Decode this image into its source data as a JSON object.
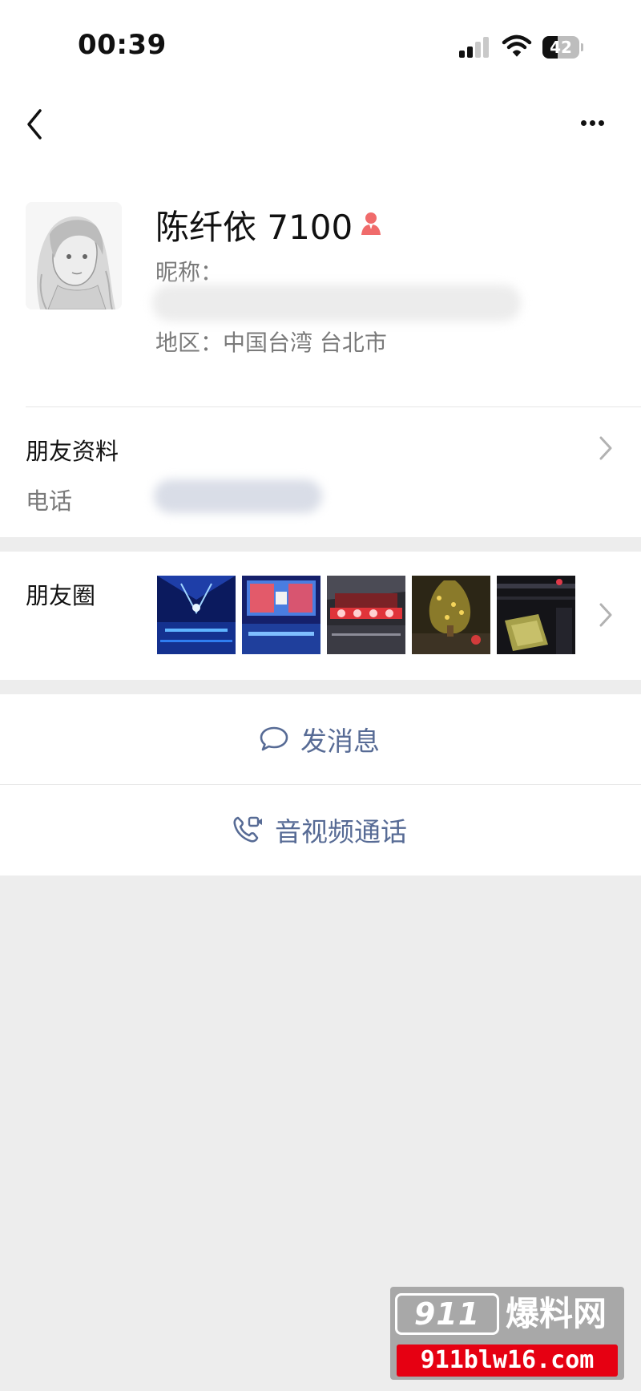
{
  "status_bar": {
    "time": "00:39",
    "battery": "42"
  },
  "profile": {
    "name": "陈纤依 7100",
    "nickname_label": "昵称：",
    "region": "地区：中国台湾 台北市"
  },
  "friend_info": {
    "title": "朋友资料",
    "phone_label": "电话"
  },
  "moments": {
    "label": "朋友圈",
    "thumbnails": [
      "moment-photo-1",
      "moment-photo-2",
      "moment-photo-3",
      "moment-photo-4",
      "moment-photo-5"
    ]
  },
  "actions": {
    "message": "发消息",
    "call": "音视频通话"
  },
  "watermark": {
    "logo_number": "911",
    "logo_text": "爆料网",
    "url": "911blw16.com"
  },
  "colors": {
    "link": "#576b95",
    "page_bg": "#ededed",
    "watermark_red": "#e60012"
  }
}
